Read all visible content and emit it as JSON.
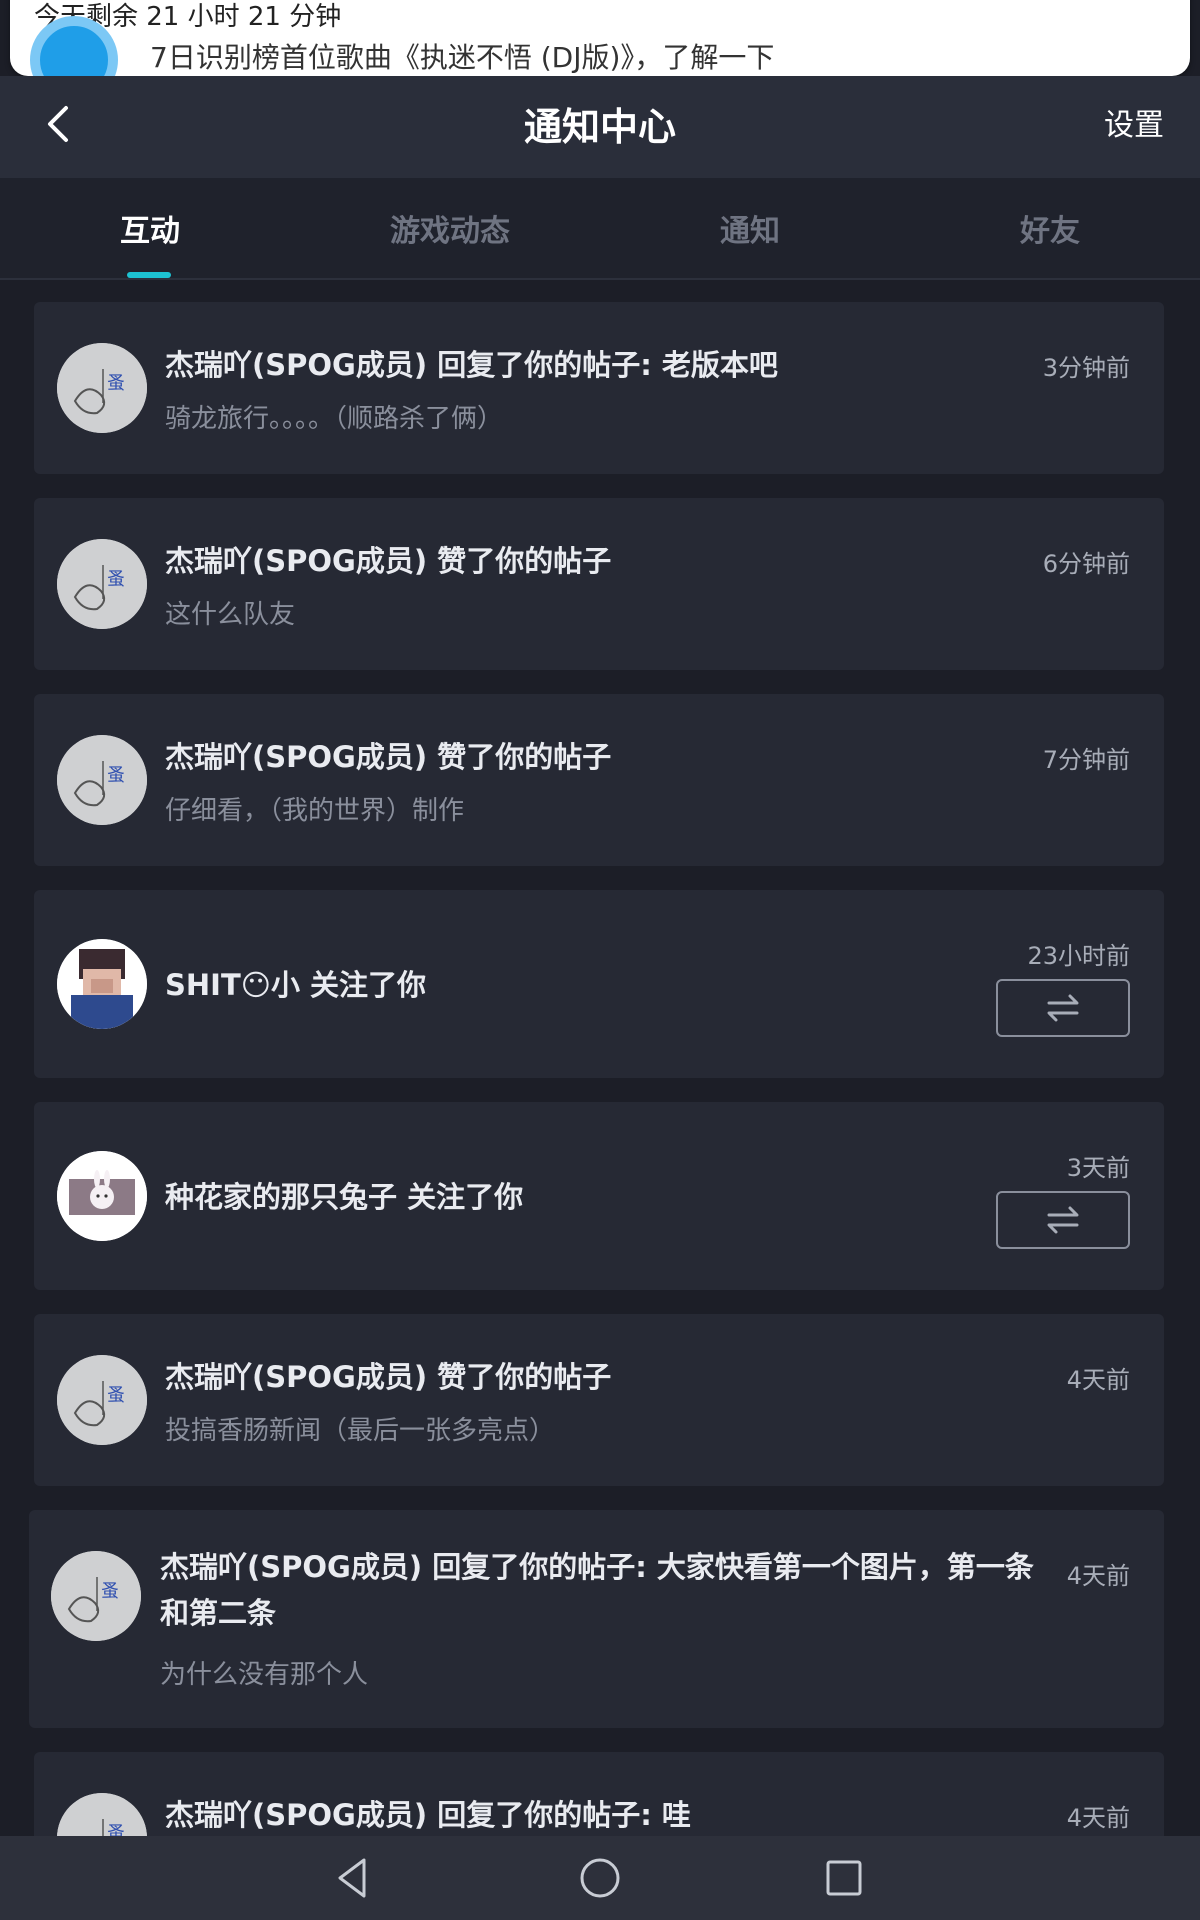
{
  "banner": {
    "title": "今天剩余 21 小时 21 分钟",
    "text": "7日识别榜首位歌曲《执迷不悟 (DJ版)》，了解一下"
  },
  "header": {
    "title": "通知中心",
    "settings_label": "设置"
  },
  "tabs": [
    {
      "label": "互动",
      "active": true
    },
    {
      "label": "游戏动态",
      "active": false
    },
    {
      "label": "通知",
      "active": false
    },
    {
      "label": "好友",
      "active": false
    }
  ],
  "notifications": [
    {
      "title": "杰瑞吖(SPOG成员) 回复了你的帖子: 老版本吧",
      "subtitle": "骑龙旅行。。。。（顺路杀了俩）",
      "time": "3分钟前",
      "avatar": "sketch-avatar"
    },
    {
      "title": "杰瑞吖(SPOG成员) 赞了你的帖子",
      "subtitle": "这什么队友",
      "time": "6分钟前",
      "avatar": "sketch-avatar"
    },
    {
      "title": "杰瑞吖(SPOG成员) 赞了你的帖子",
      "subtitle": "仔细看，（我的世界）制作",
      "time": "7分钟前",
      "avatar": "sketch-avatar"
    },
    {
      "title": "SHIT😶小 关注了你",
      "subtitle": "",
      "time": "23小时前",
      "avatar": "pixelated-photo-avatar",
      "follow_button": "mutual-follow-icon"
    },
    {
      "title": "种花家的那只兔子 关注了你",
      "subtitle": "",
      "time": "3天前",
      "avatar": "rabbit-avatar",
      "follow_button": "mutual-follow-icon"
    },
    {
      "title": "杰瑞吖(SPOG成员) 赞了你的帖子",
      "subtitle": "投搞香肠新闻（最后一张多亮点）",
      "time": "4天前",
      "avatar": "sketch-avatar"
    },
    {
      "title": "杰瑞吖(SPOG成员) 回复了你的帖子: 大家快看第一个图片，第一条和第二条",
      "subtitle": "为什么没有那个人",
      "time": "4天前",
      "avatar": "sketch-avatar"
    },
    {
      "title": "杰瑞吖(SPOG成员) 回复了你的帖子: 哇",
      "subtitle": "",
      "time": "4天前",
      "avatar": "sketch-avatar"
    }
  ],
  "colors": {
    "background": "#1c1e27",
    "card": "#262934",
    "header": "#2a2e3a",
    "accent": "#1dc2d2"
  }
}
